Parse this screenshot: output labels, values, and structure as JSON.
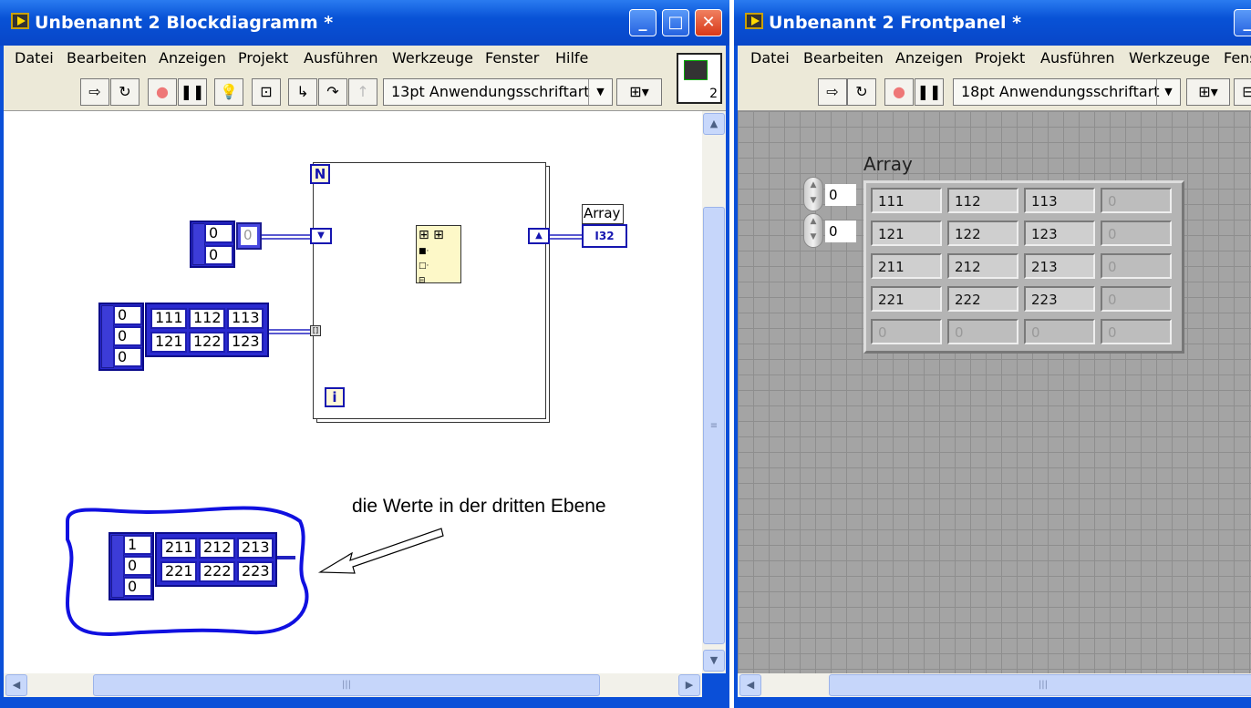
{
  "block_diagram": {
    "title": "Unbenannt 2 Blockdiagramm *",
    "menu": [
      "Datei",
      "Bearbeiten",
      "Anzeigen",
      "Projekt",
      "Ausführen",
      "Werkzeuge",
      "Fenster",
      "Hilfe"
    ],
    "font_select": "13pt Anwendungsschriftart",
    "vi_icon_number": "2",
    "index_inputs": [
      "0",
      "0"
    ],
    "init_constant": "0",
    "array_const": {
      "indices": [
        "0",
        "0",
        "0"
      ],
      "rows": [
        [
          "111",
          "112",
          "113"
        ],
        [
          "121",
          "122",
          "123"
        ]
      ]
    },
    "loop_count_label": "N",
    "loop_iteration_label": "i",
    "indicator_label": "Array",
    "indicator_type": "I32",
    "third_page": {
      "indices": [
        "1",
        "0",
        "0"
      ],
      "rows": [
        [
          "211",
          "212",
          "213"
        ],
        [
          "221",
          "222",
          "223"
        ]
      ]
    },
    "annotation": "die Werte in der dritten Ebene",
    "highlight_color": "#1010e0"
  },
  "front_panel": {
    "title": "Unbenannt 2 Frontpanel *",
    "menu": [
      "Datei",
      "Bearbeiten",
      "Anzeigen",
      "Projekt",
      "Ausführen",
      "Werkzeuge",
      "Fens"
    ],
    "font_select": "18pt Anwendungsschriftart",
    "array_label": "Array",
    "indices": [
      "0",
      "0"
    ],
    "rows": [
      [
        "111",
        "112",
        "113",
        "0"
      ],
      [
        "121",
        "122",
        "123",
        "0"
      ],
      [
        "211",
        "212",
        "213",
        "0"
      ],
      [
        "221",
        "222",
        "223",
        "0"
      ],
      [
        "0",
        "0",
        "0",
        "0"
      ]
    ]
  }
}
